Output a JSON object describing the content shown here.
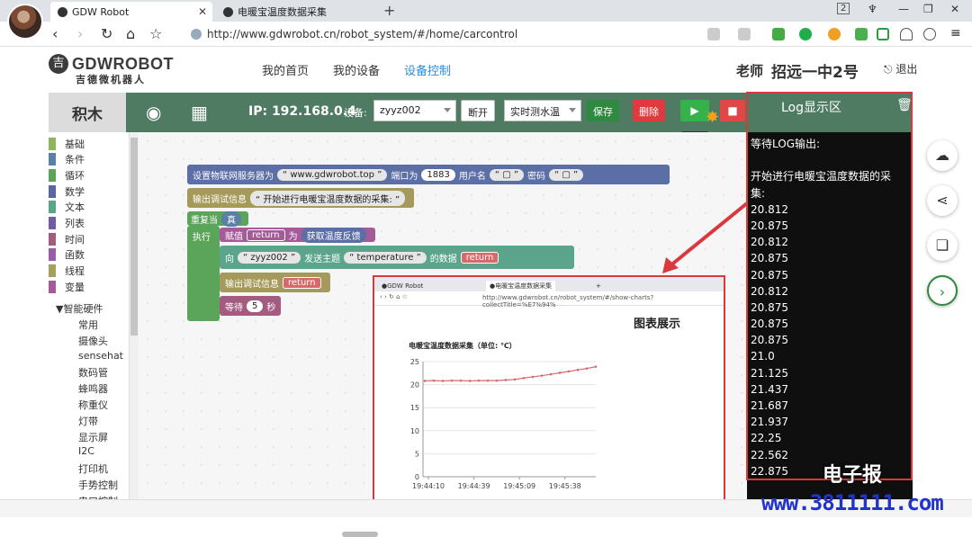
{
  "browser": {
    "tabs": [
      {
        "label": "GDW Robot"
      },
      {
        "label": "电暖宝温度数据采集"
      }
    ],
    "new_tab": "+",
    "url": "http://www.gdwrobot.cn/robot_system/#/home/carcontrol",
    "tab_count": "2"
  },
  "site": {
    "logo": "GDWROBOT",
    "logo_mark": "吉",
    "logo_sub": "吉德微机器人",
    "menu": [
      "我的首页",
      "我的设备",
      "设备控制"
    ],
    "active_menu": "设备控制",
    "user_role": "老师",
    "user_name": "招远一中2号",
    "logout": "退出"
  },
  "editor": {
    "category_header": "积木",
    "ip": "IP: 192.168.0.4",
    "device_label": "设备:",
    "device_value": "zyyz002",
    "disconnect": "断开",
    "mode_value": "实时测水温",
    "save": "保存",
    "delete": "删除",
    "run_tooltip": "运行",
    "categories": [
      {
        "label": "基础",
        "color": "#8fb45a"
      },
      {
        "label": "条件",
        "color": "#5b80a5"
      },
      {
        "label": "循环",
        "color": "#5ba55b"
      },
      {
        "label": "数学",
        "color": "#5b67a5"
      },
      {
        "label": "文本",
        "color": "#5ba58c"
      },
      {
        "label": "列表",
        "color": "#745ba5"
      },
      {
        "label": "时间",
        "color": "#a55b80"
      },
      {
        "label": "函数",
        "color": "#9a5ca6"
      },
      {
        "label": "线程",
        "color": "#a5a05b"
      },
      {
        "label": "变量",
        "color": "#a55b9a"
      }
    ],
    "hardware_header": "▼智能硬件",
    "hardware_items": [
      "常用",
      "摄像头",
      "sensehat",
      "数码管",
      "蜂鸣器",
      "称重仪",
      "灯带",
      "显示屏",
      "I2C",
      "打印机",
      "手势控制",
      "串口控制"
    ],
    "blocks": {
      "mqtt_server": "设置物联网服务器为",
      "mqtt_host": "www.gdwrobot.top",
      "port_label": "端口为",
      "port_value": "1883",
      "user_label": "用户名",
      "pass_label": "密码",
      "debug_label": "输出调试信息",
      "debug_msg": "开始进行电暖宝温度数据的采集:",
      "repeat": "重复当",
      "true": "真",
      "exec": "执行",
      "assign": "赋值",
      "var_return": "return",
      "as": "为",
      "get_temp": "获取温度反馈",
      "to": "向",
      "device": "zyyz002",
      "send_topic": "发送主题",
      "topic": "temperature",
      "data_of": "的数据",
      "wait": "等待",
      "wait_value": "5",
      "seconds": "秒",
      "quote_open": "“",
      "quote_close": "”"
    }
  },
  "log": {
    "title": "Log显示区",
    "lines": [
      "等待LOG输出:",
      "",
      "开始进行电暖宝温度数据的采",
      "集:",
      "20.812",
      "20.875",
      "20.812",
      "20.875",
      "20.875",
      "20.812",
      "20.875",
      "20.875",
      "20.875",
      "21.0",
      "21.125",
      "21.437",
      "21.687",
      "21.937",
      "22.25",
      "22.562",
      "22.875"
    ]
  },
  "popup": {
    "tabs": [
      {
        "label": "GDW Robot"
      },
      {
        "label": "电暖宝温度数据采集"
      }
    ],
    "url": "http://www.gdwrobot.cn/robot_system/#/show-charts?collectTitle=%E7%94%",
    "title": "图表展示",
    "chart_title": "电暖宝温度数据采集（单位: ℃）"
  },
  "chart_data": {
    "type": "line",
    "title": "电暖宝温度数据采集（单位: ℃）",
    "x_ticks": [
      "19:44:10",
      "19:44:39",
      "19:45:09",
      "19:45:38"
    ],
    "y_ticks": [
      0,
      5,
      10,
      15,
      20,
      25
    ],
    "ylim": [
      0,
      25
    ],
    "series": [
      {
        "values": [
          20.812,
          20.875,
          20.812,
          20.875,
          20.875,
          20.812,
          20.875,
          20.875,
          20.875,
          21.0,
          21.125,
          21.437,
          21.687,
          21.937,
          22.25,
          22.562,
          22.875,
          23.2,
          23.5,
          23.9
        ]
      }
    ],
    "colors": {
      "line": "#d66a6a",
      "axis": "#999999",
      "grid": "#e6e6e6"
    }
  },
  "watermark": {
    "brand": "电子报",
    "url": "www.3811111.com"
  },
  "colors": {
    "toolbar": "#4f7b62",
    "accent": "#2a8cd8",
    "highlight": "#d9383d"
  }
}
